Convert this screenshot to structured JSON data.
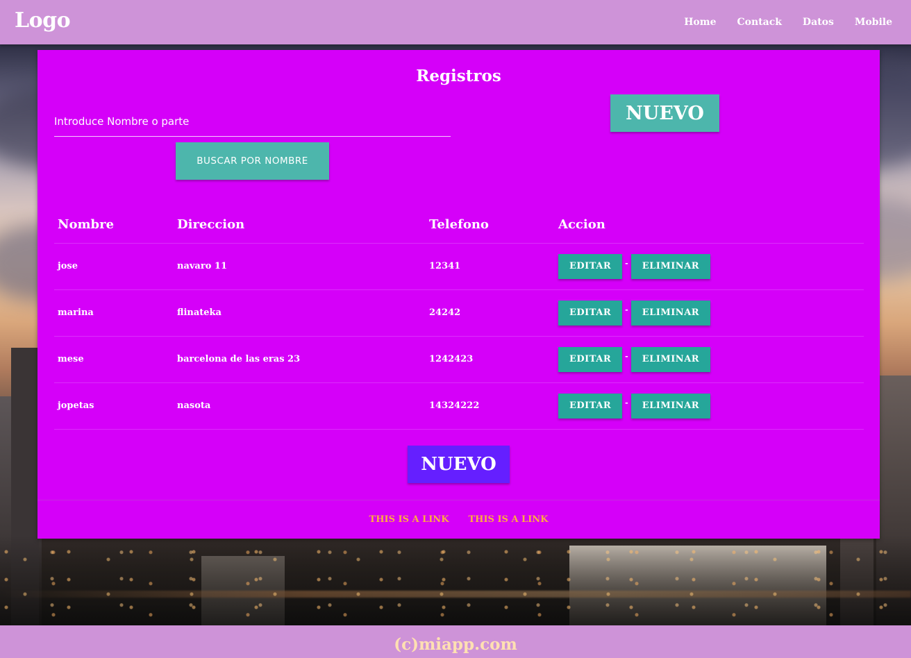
{
  "header": {
    "logo": "Logo",
    "nav": [
      "Home",
      "Contack",
      "Datos",
      "Mobile"
    ]
  },
  "card": {
    "title": "Registros",
    "search": {
      "placeholder": "Introduce Nombre o parte",
      "button": "BUSCAR POR NOMBRE"
    },
    "new_top": "NUEVO",
    "new_bottom": "NUEVO",
    "table": {
      "headers": [
        "Nombre",
        "Direccion",
        "Telefono",
        "Accion"
      ],
      "rows": [
        {
          "nombre": "jose",
          "direccion": "navaro 11",
          "telefono": "12341"
        },
        {
          "nombre": "marina",
          "direccion": "flinateka",
          "telefono": "24242"
        },
        {
          "nombre": "mese",
          "direccion": "barcelona de las eras 23",
          "telefono": "1242423"
        },
        {
          "nombre": "jopetas",
          "direccion": "nasota",
          "telefono": "14324222"
        }
      ],
      "edit_label": "EDITAR",
      "delete_label": "ELIMINAR",
      "separator": "-"
    },
    "links": [
      "THIS IS A LINK",
      "THIS IS A LINK"
    ]
  },
  "footer": {
    "text": "(c)miapp.com"
  },
  "colors": {
    "header": "#ce93d8",
    "card": "#d500f9",
    "teal": "#4db6ac",
    "teal_dark": "#26a69a",
    "purple_button": "#651fff",
    "link": "#ffab40"
  }
}
